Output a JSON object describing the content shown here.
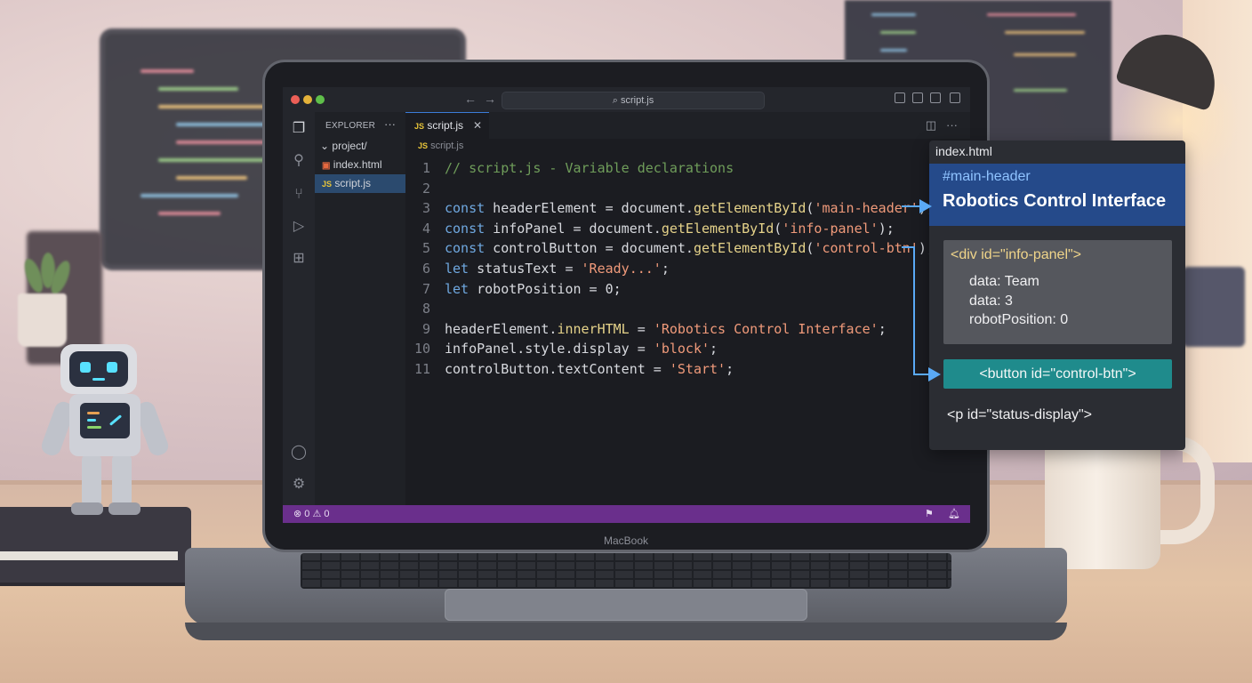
{
  "editor": {
    "title_search": "script.js",
    "sidebar": {
      "header": "EXPLORER",
      "folder": "project/",
      "files": [
        {
          "name": "index.html",
          "icon": "html-file-icon"
        },
        {
          "name": "script.js",
          "icon": "js-file-icon",
          "active": true
        }
      ]
    },
    "tab": {
      "label": "script.js",
      "glyph": "JS"
    },
    "breadcrumb": "script.js",
    "code_lines": [
      {
        "num": "1",
        "tokens": [
          {
            "t": "// script.js - Variable declarations",
            "c": "cm"
          }
        ]
      },
      {
        "num": "2",
        "tokens": []
      },
      {
        "num": "3",
        "tokens": [
          {
            "t": "const",
            "c": "kw"
          },
          {
            "t": " headerElement = document.",
            "c": "pl"
          },
          {
            "t": "getElementById",
            "c": "fn"
          },
          {
            "t": "(",
            "c": "pl"
          },
          {
            "t": "'main-header'",
            "c": "str"
          },
          {
            "t": ");",
            "c": "pl"
          }
        ]
      },
      {
        "num": "4",
        "tokens": [
          {
            "t": "const",
            "c": "kw"
          },
          {
            "t": " infoPanel = document.",
            "c": "pl"
          },
          {
            "t": "getElementById",
            "c": "fn"
          },
          {
            "t": "(",
            "c": "pl"
          },
          {
            "t": "'info-panel'",
            "c": "str"
          },
          {
            "t": ");",
            "c": "pl"
          }
        ]
      },
      {
        "num": "5",
        "tokens": [
          {
            "t": "const",
            "c": "kw"
          },
          {
            "t": " controlButton = document.",
            "c": "pl"
          },
          {
            "t": "getElementById",
            "c": "fn"
          },
          {
            "t": "(",
            "c": "pl"
          },
          {
            "t": "'control-btn'",
            "c": "str"
          },
          {
            "t": ");",
            "c": "pl"
          }
        ]
      },
      {
        "num": "6",
        "tokens": [
          {
            "t": "let",
            "c": "kw"
          },
          {
            "t": " statusText = ",
            "c": "pl"
          },
          {
            "t": "'Ready...'",
            "c": "str"
          },
          {
            "t": ";",
            "c": "pl"
          }
        ]
      },
      {
        "num": "7",
        "tokens": [
          {
            "t": "let",
            "c": "kw"
          },
          {
            "t": " robotPosition = 0;",
            "c": "pl"
          }
        ]
      },
      {
        "num": "8",
        "tokens": []
      },
      {
        "num": "9",
        "tokens": [
          {
            "t": "headerElement.",
            "c": "pl"
          },
          {
            "t": "innerHTML",
            "c": "fn"
          },
          {
            "t": " = ",
            "c": "pl"
          },
          {
            "t": "'Robotics Control Interface'",
            "c": "str"
          },
          {
            "t": ";",
            "c": "pl"
          }
        ]
      },
      {
        "num": "10",
        "tokens": [
          {
            "t": "infoPanel.style.display = ",
            "c": "pl"
          },
          {
            "t": "'block'",
            "c": "str"
          },
          {
            "t": ";",
            "c": "pl"
          }
        ]
      },
      {
        "num": "11",
        "tokens": [
          {
            "t": "controlButton.textContent = ",
            "c": "pl"
          },
          {
            "t": "'Start'",
            "c": "str"
          },
          {
            "t": ";",
            "c": "pl"
          }
        ]
      }
    ],
    "status": {
      "errors": "0",
      "warnings": "0"
    },
    "device_label": "MacBook"
  },
  "dom_panel": {
    "title": "index.html",
    "header_id": "#main-header",
    "header_text": "Robotics Control Interface",
    "info_tag": "<div id=\"info-panel\">",
    "info_rows": [
      "data: Team",
      "data: 3",
      "robotPosition: 0"
    ],
    "button_tag": "<button id=\"control-btn\">",
    "status_tag": "<p id=\"status-display\">"
  },
  "colors": {
    "accent_tab": "#3b7bd8",
    "statusbar": "#6a2f8c",
    "panel_header": "#254a8a",
    "panel_button": "#1f8b8c",
    "arrow": "#5aa9f5"
  }
}
